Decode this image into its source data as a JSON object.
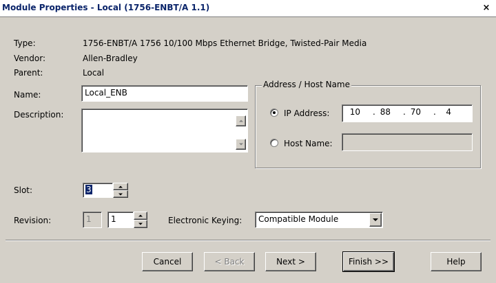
{
  "window": {
    "title": "Module Properties - Local (1756-ENBT/A 1.1)",
    "close_glyph": "×"
  },
  "info": {
    "type_label": "Type:",
    "type_value": "1756-ENBT/A 1756 10/100 Mbps Ethernet Bridge, Twisted-Pair Media",
    "vendor_label": "Vendor:",
    "vendor_value": "Allen-Bradley",
    "parent_label": "Parent:",
    "parent_value": "Local"
  },
  "name": {
    "label": "Name:",
    "value": "Local_ENB"
  },
  "description": {
    "label": "Description:",
    "value": ""
  },
  "address": {
    "group_title": "Address / Host Name",
    "ip_label": "IP Address:",
    "ip_octets": [
      "10",
      "88",
      "70",
      "4"
    ],
    "ip_selected": true,
    "host_label": "Host Name:",
    "host_value": ""
  },
  "slot": {
    "label": "Slot:",
    "value": "3"
  },
  "revision": {
    "label": "Revision:",
    "major": "1",
    "minor": "1"
  },
  "keying": {
    "label": "Electronic Keying:",
    "selected": "Compatible Module"
  },
  "buttons": {
    "cancel": "Cancel",
    "back": "< Back",
    "next": "Next >",
    "finish": "Finish >>",
    "help": "Help"
  },
  "colors": {
    "title_text": "#0a246a",
    "face": "#d4d0c8",
    "selection": "#0a246a"
  }
}
